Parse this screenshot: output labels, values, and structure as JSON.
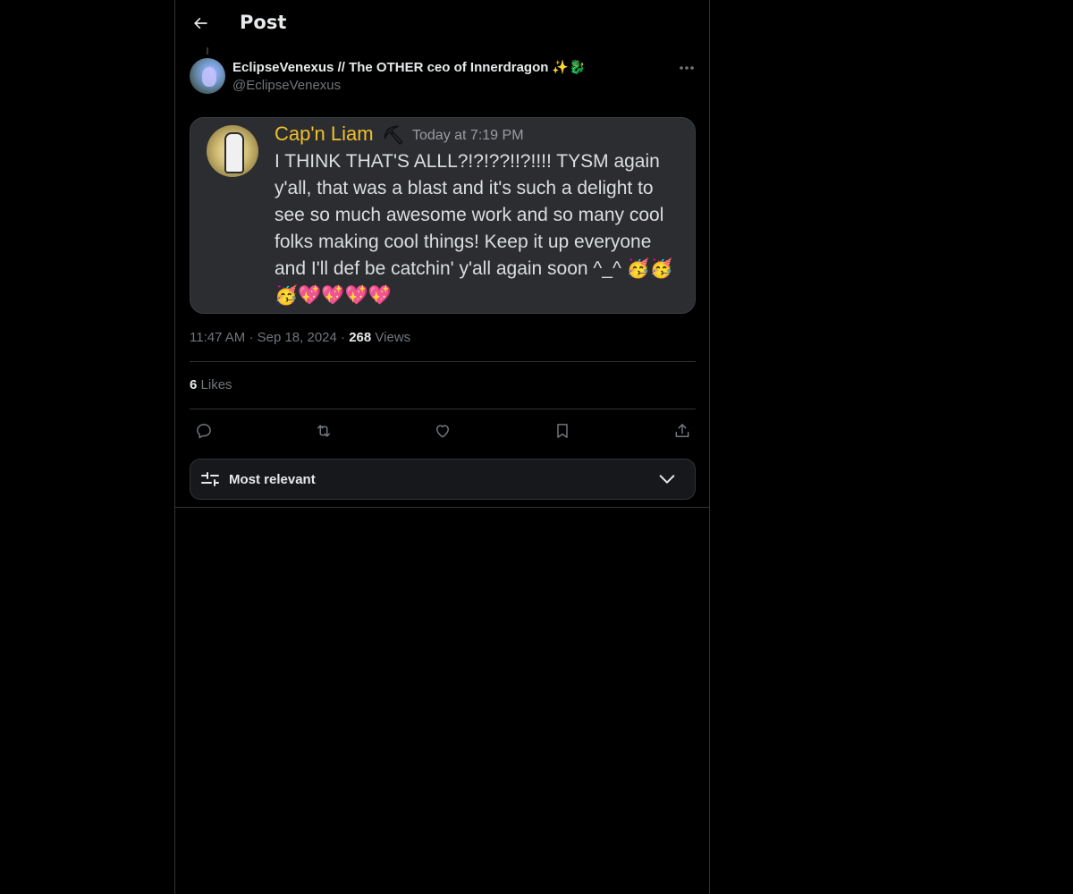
{
  "header": {
    "title": "Post",
    "back_icon": "arrow-left-icon"
  },
  "post": {
    "author_name": "EclipseVenexus // The OTHER ceo of Innerdragon",
    "author_name_emoji": "✨🐉",
    "author_handle": "@EclipseVenexus",
    "more_icon": "more-horizontal-icon",
    "embedded_message": {
      "username": "Cap'n Liam",
      "username_color": "#f0c030",
      "badge": "⛏",
      "timestamp": "Today at 7:19 PM",
      "text": "I THINK THAT'S ALLL?!?!??!!?!!!! TYSM again y'all, that was a blast and it's such a delight to see so much awesome work and so many cool folks making cool things! Keep it up everyone and I'll def be catchin' y'all again soon ^_^ 🥳🥳🥳💖💖💖💖"
    },
    "time": "11:47 AM",
    "date": "Sep 18, 2024",
    "separator": "·",
    "views_count": "268",
    "views_label": "Views",
    "likes_count": "6",
    "likes_label": "Likes"
  },
  "actions": [
    {
      "name": "reply",
      "icon": "reply-icon"
    },
    {
      "name": "repost",
      "icon": "repost-icon"
    },
    {
      "name": "like",
      "icon": "heart-icon"
    },
    {
      "name": "bookmark",
      "icon": "bookmark-icon"
    },
    {
      "name": "share",
      "icon": "share-icon"
    }
  ],
  "replies_sort": {
    "label": "Most relevant",
    "icon": "sliders-icon",
    "chevron": "chevron-down-icon"
  },
  "colors": {
    "background": "#000000",
    "text_primary": "#e7e9ea",
    "text_secondary": "#71767b",
    "border": "#2f3336"
  }
}
